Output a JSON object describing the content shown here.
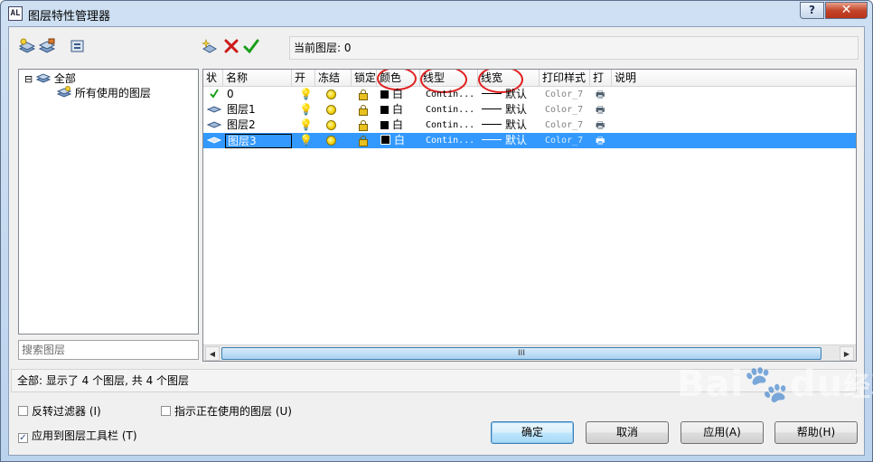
{
  "window": {
    "title": "图层特性管理器",
    "help_label": "?",
    "close_label": "✕",
    "app_icon_label": "AL"
  },
  "current_layer": "当前图层: 0",
  "tree": {
    "root": "全部",
    "child": "所有使用的图层",
    "expander": "⊟"
  },
  "search": {
    "placeholder": "搜索图层"
  },
  "columns": [
    "状",
    "名称",
    "开",
    "冻结",
    "锁定",
    "颜色",
    "线型",
    "线宽",
    "打印样式",
    "打",
    "说明"
  ],
  "layers": [
    {
      "name": "0",
      "color": "白",
      "linetype": "Contin...",
      "lineweight": "默认",
      "plot_style": "Color_7",
      "current": true,
      "selected": false
    },
    {
      "name": "图层1",
      "color": "白",
      "linetype": "Contin...",
      "lineweight": "默认",
      "plot_style": "Color_7",
      "current": false,
      "selected": false
    },
    {
      "name": "图层2",
      "color": "白",
      "linetype": "Contin...",
      "lineweight": "默认",
      "plot_style": "Color_7",
      "current": false,
      "selected": false
    },
    {
      "name": "图层3",
      "color": "白",
      "linetype": "Contin...",
      "lineweight": "默认",
      "plot_style": "Color_7",
      "current": false,
      "selected": true
    }
  ],
  "scroll": {
    "thumb_grip": "III",
    "left": "◀",
    "right": "▶"
  },
  "status": "全部: 显示了 4 个图层, 共 4 个图层",
  "options": {
    "invert_filter": {
      "label": "反转过滤器 (I)",
      "checked": false
    },
    "apply_toolbar": {
      "label": "应用到图层工具栏 (T)",
      "checked": true
    },
    "indicate_used": {
      "label": "指示正在使用的图层 (U)",
      "checked": false
    }
  },
  "buttons": {
    "ok": "确定",
    "cancel": "取消",
    "apply": "应用(A)",
    "help": "帮助(H)"
  },
  "watermark": {
    "main": "Bai",
    "mid": "du",
    "suffix": "经验"
  },
  "colors": {
    "selection": "#3399ff",
    "annotation_circle": "#e02020",
    "delete_icon": "#cc1a1a",
    "current_icon": "#1a9e1a"
  },
  "icons": [
    "new-property-filter-icon",
    "new-group-filter-icon",
    "layer-states-manager-icon",
    "new-layer-icon",
    "delete-layer-icon",
    "set-current-icon",
    "lightbulb-icon",
    "sun-icon",
    "lock-icon",
    "printer-icon"
  ]
}
